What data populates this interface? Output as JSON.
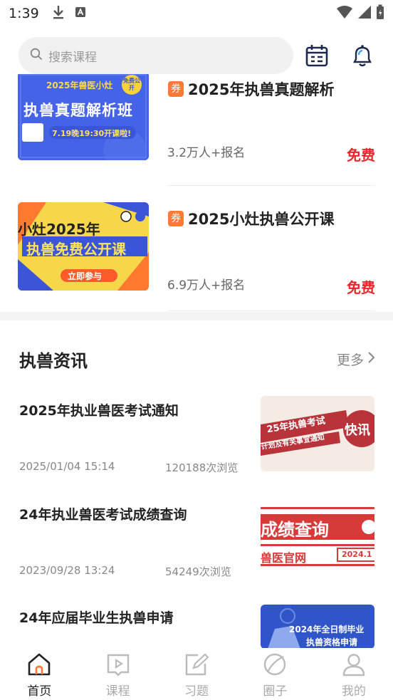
{
  "status_bar": {
    "time": "1:39"
  },
  "search": {
    "placeholder": "搜索课程"
  },
  "header_icons": {
    "calendar": "calendar-icon",
    "notification": "bell-icon"
  },
  "courses": [
    {
      "title": "2025年执兽真题解析",
      "coupon": "券",
      "signups": "3.2万人+报名",
      "price": "免费",
      "thumb": {
        "line1": "2025年兽医小灶",
        "line2": "执兽真题解析班",
        "line3": "7.19晚19:30开课啦!",
        "badge": "免费公开"
      }
    },
    {
      "title": "2025小灶执兽公开课",
      "coupon": "券",
      "signups": "6.9万人+报名",
      "price": "免费",
      "thumb": {
        "line1": "小灶2025年",
        "line2": "执兽免费公开课",
        "button": "立即参与"
      }
    }
  ],
  "news_section": {
    "title": "执兽资讯",
    "more": "更多"
  },
  "news": [
    {
      "title": "2025年执业兽医考试通知",
      "date": "2025/01/04 15:14",
      "views": "120188次浏览",
      "thumb": {
        "line1": "25年执兽考试",
        "line2": "计划及有关事宜通知",
        "badge": "快讯"
      }
    },
    {
      "title": "24年执业兽医考试成绩查询",
      "date": "2023/09/28 13:24",
      "views": "54249次浏览",
      "thumb": {
        "line1": "成绩查询",
        "line2": "兽医官网",
        "date": "2024.1"
      }
    },
    {
      "title": "24年应届毕业生执兽申请",
      "date": "",
      "views": "",
      "thumb": {
        "line1": "2024年全日制毕业",
        "line2": "执兽资格申请"
      }
    }
  ],
  "tabbar": [
    {
      "label": "首页",
      "icon": "home-icon",
      "active": true
    },
    {
      "label": "课程",
      "icon": "course-icon",
      "active": false
    },
    {
      "label": "习题",
      "icon": "exercise-icon",
      "active": false
    },
    {
      "label": "圈子",
      "icon": "circle-icon",
      "active": false
    },
    {
      "label": "我的",
      "icon": "profile-icon",
      "active": false
    }
  ],
  "colors": {
    "accent": "#ff7a36",
    "price": "#e8262b",
    "active_tab": "#222222",
    "inactive_tab": "#aaaaaa"
  }
}
